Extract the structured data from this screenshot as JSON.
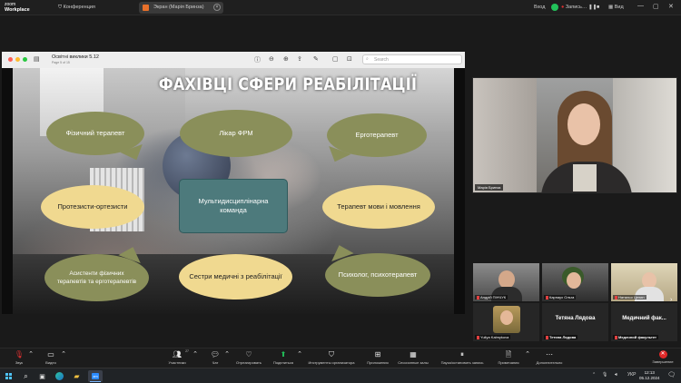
{
  "topbar": {
    "logo_line1": "zoom",
    "logo_line2": "Workplace",
    "conference_label": "Конференция",
    "share_tab_label": "Экран (Марія Бринза)",
    "login_label": "Вход",
    "recording_label": "Запись…",
    "view_label": "Вид"
  },
  "viewer": {
    "doc_title": "Освітні виклики 5.12",
    "page_info": "Page 5 of 15",
    "search_placeholder": "Search"
  },
  "slide": {
    "title": "ФАХІВЦІ СФЕРИ РЕАБІЛІТАЦІЇ",
    "center": "Мультидисциплінарна команда",
    "bubbles": [
      {
        "text": "Фізичний терапевт",
        "color": "green"
      },
      {
        "text": "Лікар ФРМ",
        "color": "green"
      },
      {
        "text": "Ерготерапевт",
        "color": "green"
      },
      {
        "text": "Протезисти-ортезисти",
        "color": "yellow"
      },
      {
        "text": "Терапевт мови і мовлення",
        "color": "yellow"
      },
      {
        "text": "Асистенти фізичних терапевтів та ерготерапевтів",
        "color": "green"
      },
      {
        "text": "Сестри медичні з реабілітації",
        "color": "yellow"
      },
      {
        "text": "Психолог, психотерапевт",
        "color": "green"
      }
    ]
  },
  "speaker": {
    "name": "Марія Бринза"
  },
  "participants": [
    {
      "name": "Андрій ПІНЧУК"
    },
    {
      "name": "Карнаух Ольга"
    },
    {
      "name": "Наталья Целин"
    },
    {
      "name": "Yuliya Kalmykova"
    },
    {
      "name": "Тетяна Лядова",
      "big": "Тетяна Лядова"
    },
    {
      "name": "Медичний факультет",
      "big": "Медичний фак..."
    }
  ],
  "toolbar": {
    "audio": "Звук",
    "video": "Видео",
    "participants": "Участники",
    "participants_count": "27",
    "chat": "Чат",
    "react": "Отреагировать",
    "share": "Поделиться",
    "host_tools": "Инструменты организатора",
    "apps": "Приложения",
    "breakout": "Сессионные залы",
    "record": "Пауза/остановить запись",
    "notes": "Примечания",
    "more": "Дополнительно",
    "end": "Завершение"
  },
  "taskbar": {
    "lang": "УКР",
    "time": "12:13",
    "date": "05.12.2024"
  },
  "colors": {
    "green_bubble": "#8a8f5a",
    "yellow_bubble": "#f0d990",
    "center_box": "#4d7a7c",
    "end_red": "#e02828",
    "share_green": "#22c25a"
  }
}
